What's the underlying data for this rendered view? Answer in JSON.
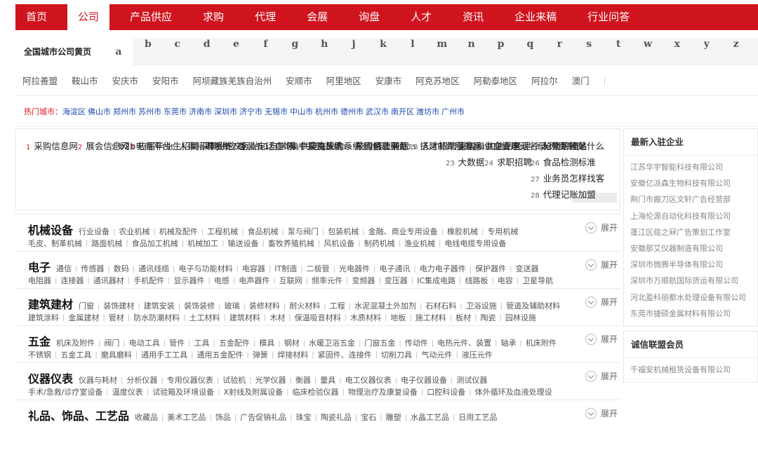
{
  "nav": {
    "items": [
      {
        "label": "首页",
        "active": false
      },
      {
        "label": "公司",
        "active": true
      },
      {
        "label": "产品供应",
        "active": false
      },
      {
        "label": "求购",
        "active": false
      },
      {
        "label": "代理",
        "active": false
      },
      {
        "label": "会展",
        "active": false
      },
      {
        "label": "询盘",
        "active": false
      },
      {
        "label": "人才",
        "active": false
      },
      {
        "label": "资讯",
        "active": false
      },
      {
        "label": "企业来稿",
        "active": false
      },
      {
        "label": "行业问答",
        "active": false
      }
    ]
  },
  "alphabet": {
    "title": "全国城市公司黄页",
    "letters": [
      "a",
      "b",
      "c",
      "d",
      "e",
      "f",
      "g",
      "h",
      "j",
      "k",
      "l",
      "m",
      "n",
      "p",
      "q",
      "r",
      "s",
      "t",
      "w",
      "x",
      "y",
      "z"
    ],
    "active": "a"
  },
  "cities": [
    "阿拉善盟",
    "鞍山市",
    "安庆市",
    "安阳市",
    "阿坝藏族羌族自治州",
    "安顺市",
    "阿里地区",
    "安康市",
    "阿克苏地区",
    "阿勒泰地区",
    "阿拉尔",
    "澳门"
  ],
  "hot": {
    "label": "热门城市：",
    "cities": [
      "海淀区",
      "佛山市",
      "郑州市",
      "苏州市",
      "东莞市",
      "济南市",
      "深圳市",
      "济宁市",
      "无锡市",
      "中山市",
      "杭州市",
      "德州市",
      "武汉市",
      "南开区",
      "潍坊市",
      "广州市"
    ]
  },
  "keywords": {
    "columns": [
      [
        {
          "n": "1",
          "t": "采购信息网"
        },
        {
          "n": "2",
          "t": "展会信息网"
        },
        {
          "n": "3",
          "t": "应届毕业生招聘"
        },
        {
          "n": "4",
          "t": "毕业论文网站"
        }
      ],
      [
        {
          "n": "5",
          "t": "b2b电商平台"
        },
        {
          "n": "6",
          "t": "人事招聘系统"
        },
        {
          "n": "7",
          "t": "企业电话查询"
        },
        {
          "n": "8",
          "t": "供应商采购系统"
        }
      ],
      [
        {
          "n": "9",
          "t": "采购供应商"
        },
        {
          "n": "10",
          "t": "51自学网"
        },
        {
          "n": "11",
          "t": "爬虫技术"
        },
        {
          "n": "12",
          "t": "校园招聘网站"
        }
      ],
      [
        {
          "n": "13",
          "t": "集中采购系统"
        },
        {
          "n": "14",
          "t": "采购信息平台"
        },
        {
          "n": "15",
          "t": "搭建邮件服务器"
        },
        {
          "n": "16",
          "t": "企业电话名录"
        }
      ],
      [
        {
          "n": "17",
          "t": "线上兼职"
        },
        {
          "n": "18",
          "t": "人才招聘信息"
        },
        {
          "n": "19",
          "t": "加油站经理"
        },
        {
          "n": "20",
          "t": "分销系统是什么"
        }
      ],
      [
        {
          "n": "21",
          "t": "采购和供应管理"
        },
        {
          "n": "22",
          "t": "个人网页制作"
        },
        {
          "n": "23",
          "t": "大数据"
        },
        {
          "n": "24",
          "t": "求职招聘"
        }
      ],
      [
        {
          "n": "25",
          "t": "论文的网站"
        },
        {
          "n": "26",
          "t": "食品检测标准"
        },
        {
          "n": "27",
          "t": "业务员怎样找客"
        },
        {
          "n": "28",
          "t": "代理记账加盟"
        }
      ]
    ]
  },
  "categories": [
    {
      "title": "机械设备",
      "line1": [
        "行业设备",
        "农业机械",
        "机械及配件",
        "工程机械",
        "食品机械",
        "泵与阀门",
        "包装机械",
        "金融、商业专用设备",
        "橡胶机械",
        "专用机械"
      ],
      "line2": [
        "毛皮、制革机械",
        "路面机械",
        "食品加工机械",
        "机械加工",
        "输送设备",
        "畜牧养殖机械",
        "风机设备",
        "制药机械",
        "渔业机械",
        "电线电缆专用设备"
      ],
      "expand": "展开"
    },
    {
      "title": "电子",
      "line1": [
        "通信",
        "传感器",
        "数码",
        "通讯线缆",
        "电子与功能材料",
        "电容器",
        "IT制造",
        "二极管",
        "光电器件",
        "电子通讯",
        "电力电子器件",
        "保护器件",
        "变送器"
      ],
      "line2": [
        "电阻器",
        "连接器",
        "通讯器材",
        "手机配件",
        "显示器件",
        "电感",
        "电声器件",
        "互联网",
        "频率元件",
        "变频器",
        "变压器",
        "IC集成电路",
        "线路板",
        "电容",
        "卫星导航"
      ],
      "expand": "展开"
    },
    {
      "title": "建筑建材",
      "line1": [
        "门窗",
        "装饰建材",
        "建筑安装",
        "装饰装修",
        "玻璃",
        "装修材料",
        "耐火材料",
        "工程",
        "水泥混凝土外加剂",
        "石材石料",
        "卫浴设施",
        "管道及辅助材料"
      ],
      "line2": [
        "建筑涂料",
        "金属建材",
        "管材",
        "防水防潮材料",
        "土工材料",
        "建筑材料",
        "木材",
        "保温吸音材料",
        "木质材料",
        "地板",
        "施工材料",
        "板材",
        "陶瓷",
        "园林设施"
      ],
      "expand": "展开"
    },
    {
      "title": "五金",
      "line1": [
        "机床及附件",
        "阀门",
        "电动工具",
        "管件",
        "工具",
        "五金配件",
        "模具",
        "钢材",
        "水暖卫浴五金",
        "门窗五金",
        "传动件",
        "电热元件、装置",
        "轴承",
        "机床附件"
      ],
      "line2": [
        "不锈钢",
        "五金工具",
        "磨具磨料",
        "通用手工工具",
        "通用五金配件",
        "弹簧",
        "焊接材料",
        "紧固件、连接件",
        "切削刀具",
        "气动元件",
        "液压元件"
      ],
      "expand": "展开"
    },
    {
      "title": "仪器仪表",
      "line1": [
        "仪器与耗材",
        "分析仪器",
        "专用仪器仪表",
        "试验机",
        "光学仪器",
        "衡器",
        "量具",
        "电工仪器仪表",
        "电子仪器设备",
        "测试仪器"
      ],
      "line2": [
        "手术/急救/诊疗室设备",
        "温度仪表",
        "试验箱及环境设备",
        "X射线及附属设备",
        "临床检验仪器",
        "物理治疗及康复设备",
        "口腔科设备",
        "体外循环及血液处理设"
      ],
      "expand": "展开"
    },
    {
      "title": "礼品、饰品、工艺品",
      "line1": [
        "收藏品",
        "美术工艺品",
        "饰品",
        "广告促销礼品",
        "珠宝",
        "陶瓷礼品",
        "宝石",
        "雕塑",
        "水晶工艺品",
        "日用工艺品"
      ],
      "line2": [],
      "expand": "展开"
    }
  ],
  "sidebar": {
    "new_title": "最新入驻企业",
    "new_items": [
      "江苏华宇智能科技有限公司",
      "安徽亿派森生物科技有限公司",
      "荆门市搬刀区文轩广告经营部",
      "上海伦源自动化科技有限公司",
      "蓬江区缆之冧广告策划工作室",
      "安徽那艾仪器制造有限公司",
      "深圳市微腾半导体有限公司",
      "深圳市万顺航国际货运有限公司",
      "河北盈科丽都水处理设备有限公司",
      "东莞市捷硕金属材料有限公司"
    ],
    "alliance_title": "诚信联盟会员",
    "alliance_items": [
      "千福安机械租赁设备有限公司"
    ]
  }
}
